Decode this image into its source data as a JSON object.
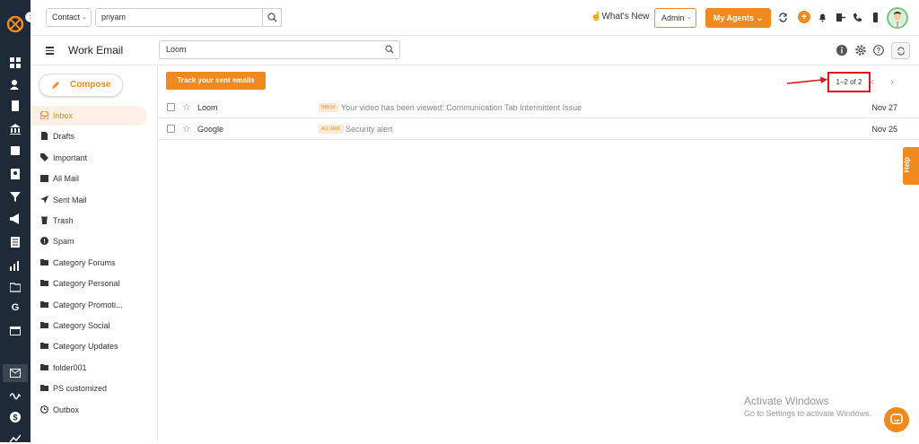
{
  "topbar": {
    "module_select": "Contact",
    "search_value": "priyam",
    "whats_new": "What's New",
    "role_select": "Admin",
    "my_agents": "My Agents"
  },
  "subbar": {
    "title": "Work Email",
    "mail_search_value": "Loom"
  },
  "sidebar": {
    "compose": "Compose",
    "folders": [
      {
        "label": "Inbox",
        "icon": "inbox-icon",
        "active": true
      },
      {
        "label": "Drafts",
        "icon": "draft-icon"
      },
      {
        "label": "Important",
        "icon": "tag-icon"
      },
      {
        "label": "All Mail",
        "icon": "allmail-icon"
      },
      {
        "label": "Sent Mail",
        "icon": "send-icon"
      },
      {
        "label": "Trash",
        "icon": "trash-icon"
      },
      {
        "label": "Spam",
        "icon": "spam-icon"
      },
      {
        "label": "Category Forums",
        "icon": "folder-icon"
      },
      {
        "label": "Category Personal",
        "icon": "folder-icon"
      },
      {
        "label": "Category Promoti...",
        "icon": "folder-icon"
      },
      {
        "label": "Category Social",
        "icon": "folder-icon"
      },
      {
        "label": "Category Updates",
        "icon": "folder-icon"
      },
      {
        "label": "folder001",
        "icon": "folder-icon"
      },
      {
        "label": "PS customized",
        "icon": "folder-icon"
      },
      {
        "label": "Outbox",
        "icon": "outbox-icon"
      }
    ]
  },
  "main": {
    "track_button": "Track your sent emails",
    "pagination": "1–2 of 2",
    "emails": [
      {
        "from": "Loom",
        "label": "INBOX",
        "subject": "Your video has been viewed: Communication Tab Intermittent Issue",
        "date": "Nov 27"
      },
      {
        "from": "Google",
        "label": "ALL MAIL",
        "subject": "Security alert",
        "date": "Nov 25"
      }
    ]
  },
  "help_tab": "Help",
  "watermark": {
    "title": "Activate Windows",
    "subtitle": "Go to Settings to activate Windows."
  },
  "colors": {
    "accent": "#f0891e",
    "rail": "#1e2a38",
    "annotation": "#e0151b"
  }
}
